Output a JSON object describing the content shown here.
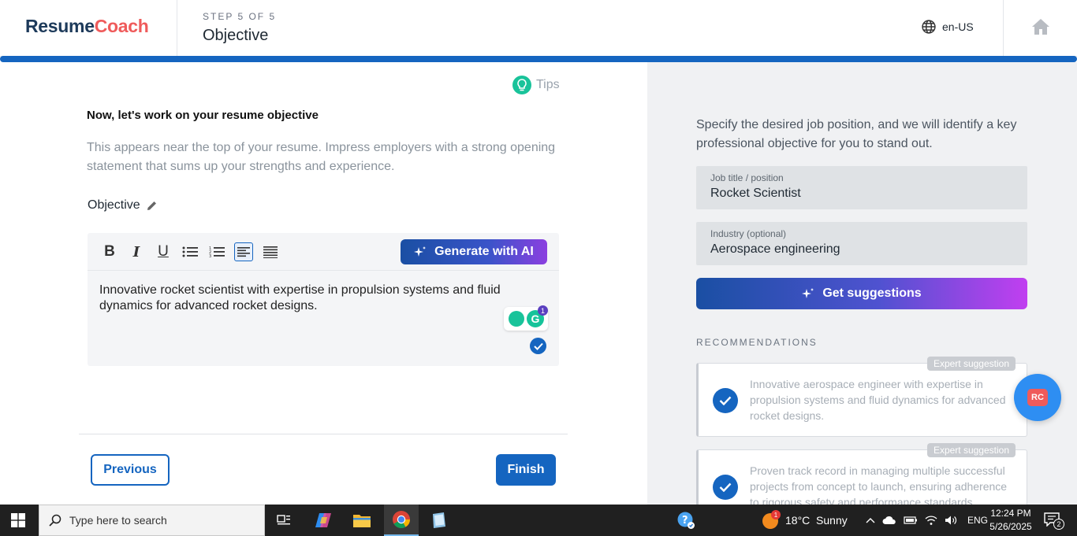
{
  "header": {
    "logo_part1": "Resume",
    "logo_part2": "Coach",
    "step_label": "STEP 5 OF 5",
    "step_title": "Objective",
    "language": "en-US"
  },
  "progress_percent": 100,
  "form": {
    "tips_label": "Tips",
    "section_heading": "Now, let's work on your resume objective",
    "section_description": "This appears near the top of your resume. Impress employers with a strong opening statement that sums up your strengths and experience.",
    "objective_label": "Objective",
    "generate_ai_label": "Generate with AI",
    "objective_text": "Innovative rocket scientist with expertise in propulsion systems and fluid dynamics for advanced rocket designs.",
    "grammarly_count": "1",
    "previous_label": "Previous",
    "finish_label": "Finish"
  },
  "sidebar": {
    "description": "Specify the desired job position, and we will identify a key professional objective for you to stand out.",
    "job_title_label": "Job title / position",
    "job_title_value": "Rocket Scientist",
    "industry_label": "Industry (optional)",
    "industry_value": "Aerospace engineering",
    "get_suggestions_label": "Get suggestions",
    "recommendations_heading": "RECOMMENDATIONS",
    "recommendations": [
      {
        "tag": "Expert suggestion",
        "text": "Innovative aerospace engineer with expertise in propulsion systems and fluid dynamics for advanced rocket designs."
      },
      {
        "tag": "Expert suggestion",
        "text": "Proven track record in managing multiple successful projects from concept to launch, ensuring adherence to rigorous safety and performance standards."
      }
    ],
    "chat_bubble_label": "RC"
  },
  "taskbar": {
    "search_placeholder": "Type here to search",
    "weather_badge": "1",
    "weather": "18°C  Sunny",
    "language": "ENG",
    "time": "12:24 PM",
    "date": "5/26/2025",
    "notifications": "2"
  },
  "colors": {
    "brand_dark": "#1d3a5a",
    "brand_accent": "#ef5b5b",
    "primary": "#1565c0"
  }
}
